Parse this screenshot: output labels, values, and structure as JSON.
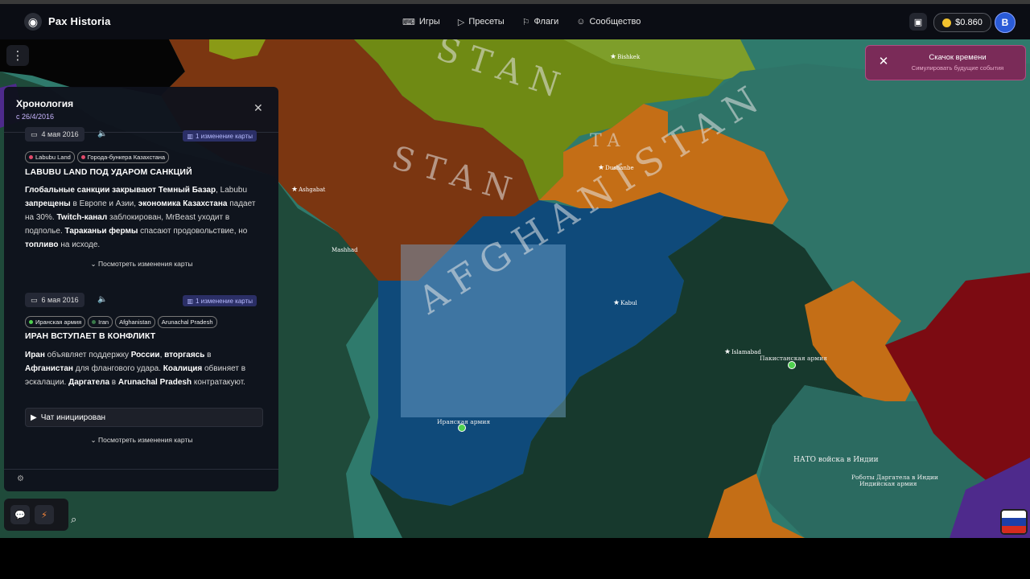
{
  "header": {
    "brand": "Pax Historia",
    "nav": [
      {
        "label": "Игры",
        "icon": "gamepad-icon"
      },
      {
        "label": "Пресеты",
        "icon": "play-icon"
      },
      {
        "label": "Флаги",
        "icon": "flag-icon"
      },
      {
        "label": "Сообщество",
        "icon": "users-icon"
      }
    ],
    "balance": "$0.860",
    "avatar_letter": "B"
  },
  "toast": {
    "title": "Скачок времени",
    "subtitle": "Симулировать будущие события"
  },
  "timeline": {
    "title": "Хронология",
    "since": "с 26/4/2016",
    "entries": [
      {
        "date": "4 мая 2016",
        "map_changes": "1 изменение карты",
        "tags": [
          "Labubu Land",
          "Города-бункера Казахстана"
        ],
        "headline": "LABUBU LAND ПОД УДАРОМ САНКЦИЙ",
        "view_changes": "Посмотреть изменения карты"
      },
      {
        "date": "6 мая 2016",
        "map_changes": "1 изменение карты",
        "tags": [
          "Иранская армия",
          "Iran",
          "Afghanistan",
          "Arunachal Pradesh"
        ],
        "headline": "ИРАН ВСТУПАЕТ В КОНФЛИКТ",
        "chat": "Чат инициирован",
        "view_changes": "Посмотреть изменения карты"
      }
    ]
  },
  "map": {
    "region_labels": [
      "STAN",
      "STAN",
      "AFGHANISTAN",
      "TA"
    ],
    "cities": [
      "Ashgabat",
      "Mashhad",
      "Dushanbe",
      "Kabul",
      "Islamabad",
      "Bishkek"
    ],
    "units": [
      "Пакистанская армия",
      "Иранская армия",
      "НАТО войска в Индии",
      "Роботы Даргатела в Индии",
      "Индийская армия"
    ]
  },
  "colors": {
    "afghanistan": "#0f4a7a",
    "pakistan": "#17392d",
    "kazakh_brown": "#7b3611",
    "tajik_orange": "#c46e16",
    "kyrgyz_olive": "#6f8a14",
    "china_teal": "#2f7468",
    "india_red": "#7c0b12",
    "toast_bg": "#7a2b58"
  }
}
